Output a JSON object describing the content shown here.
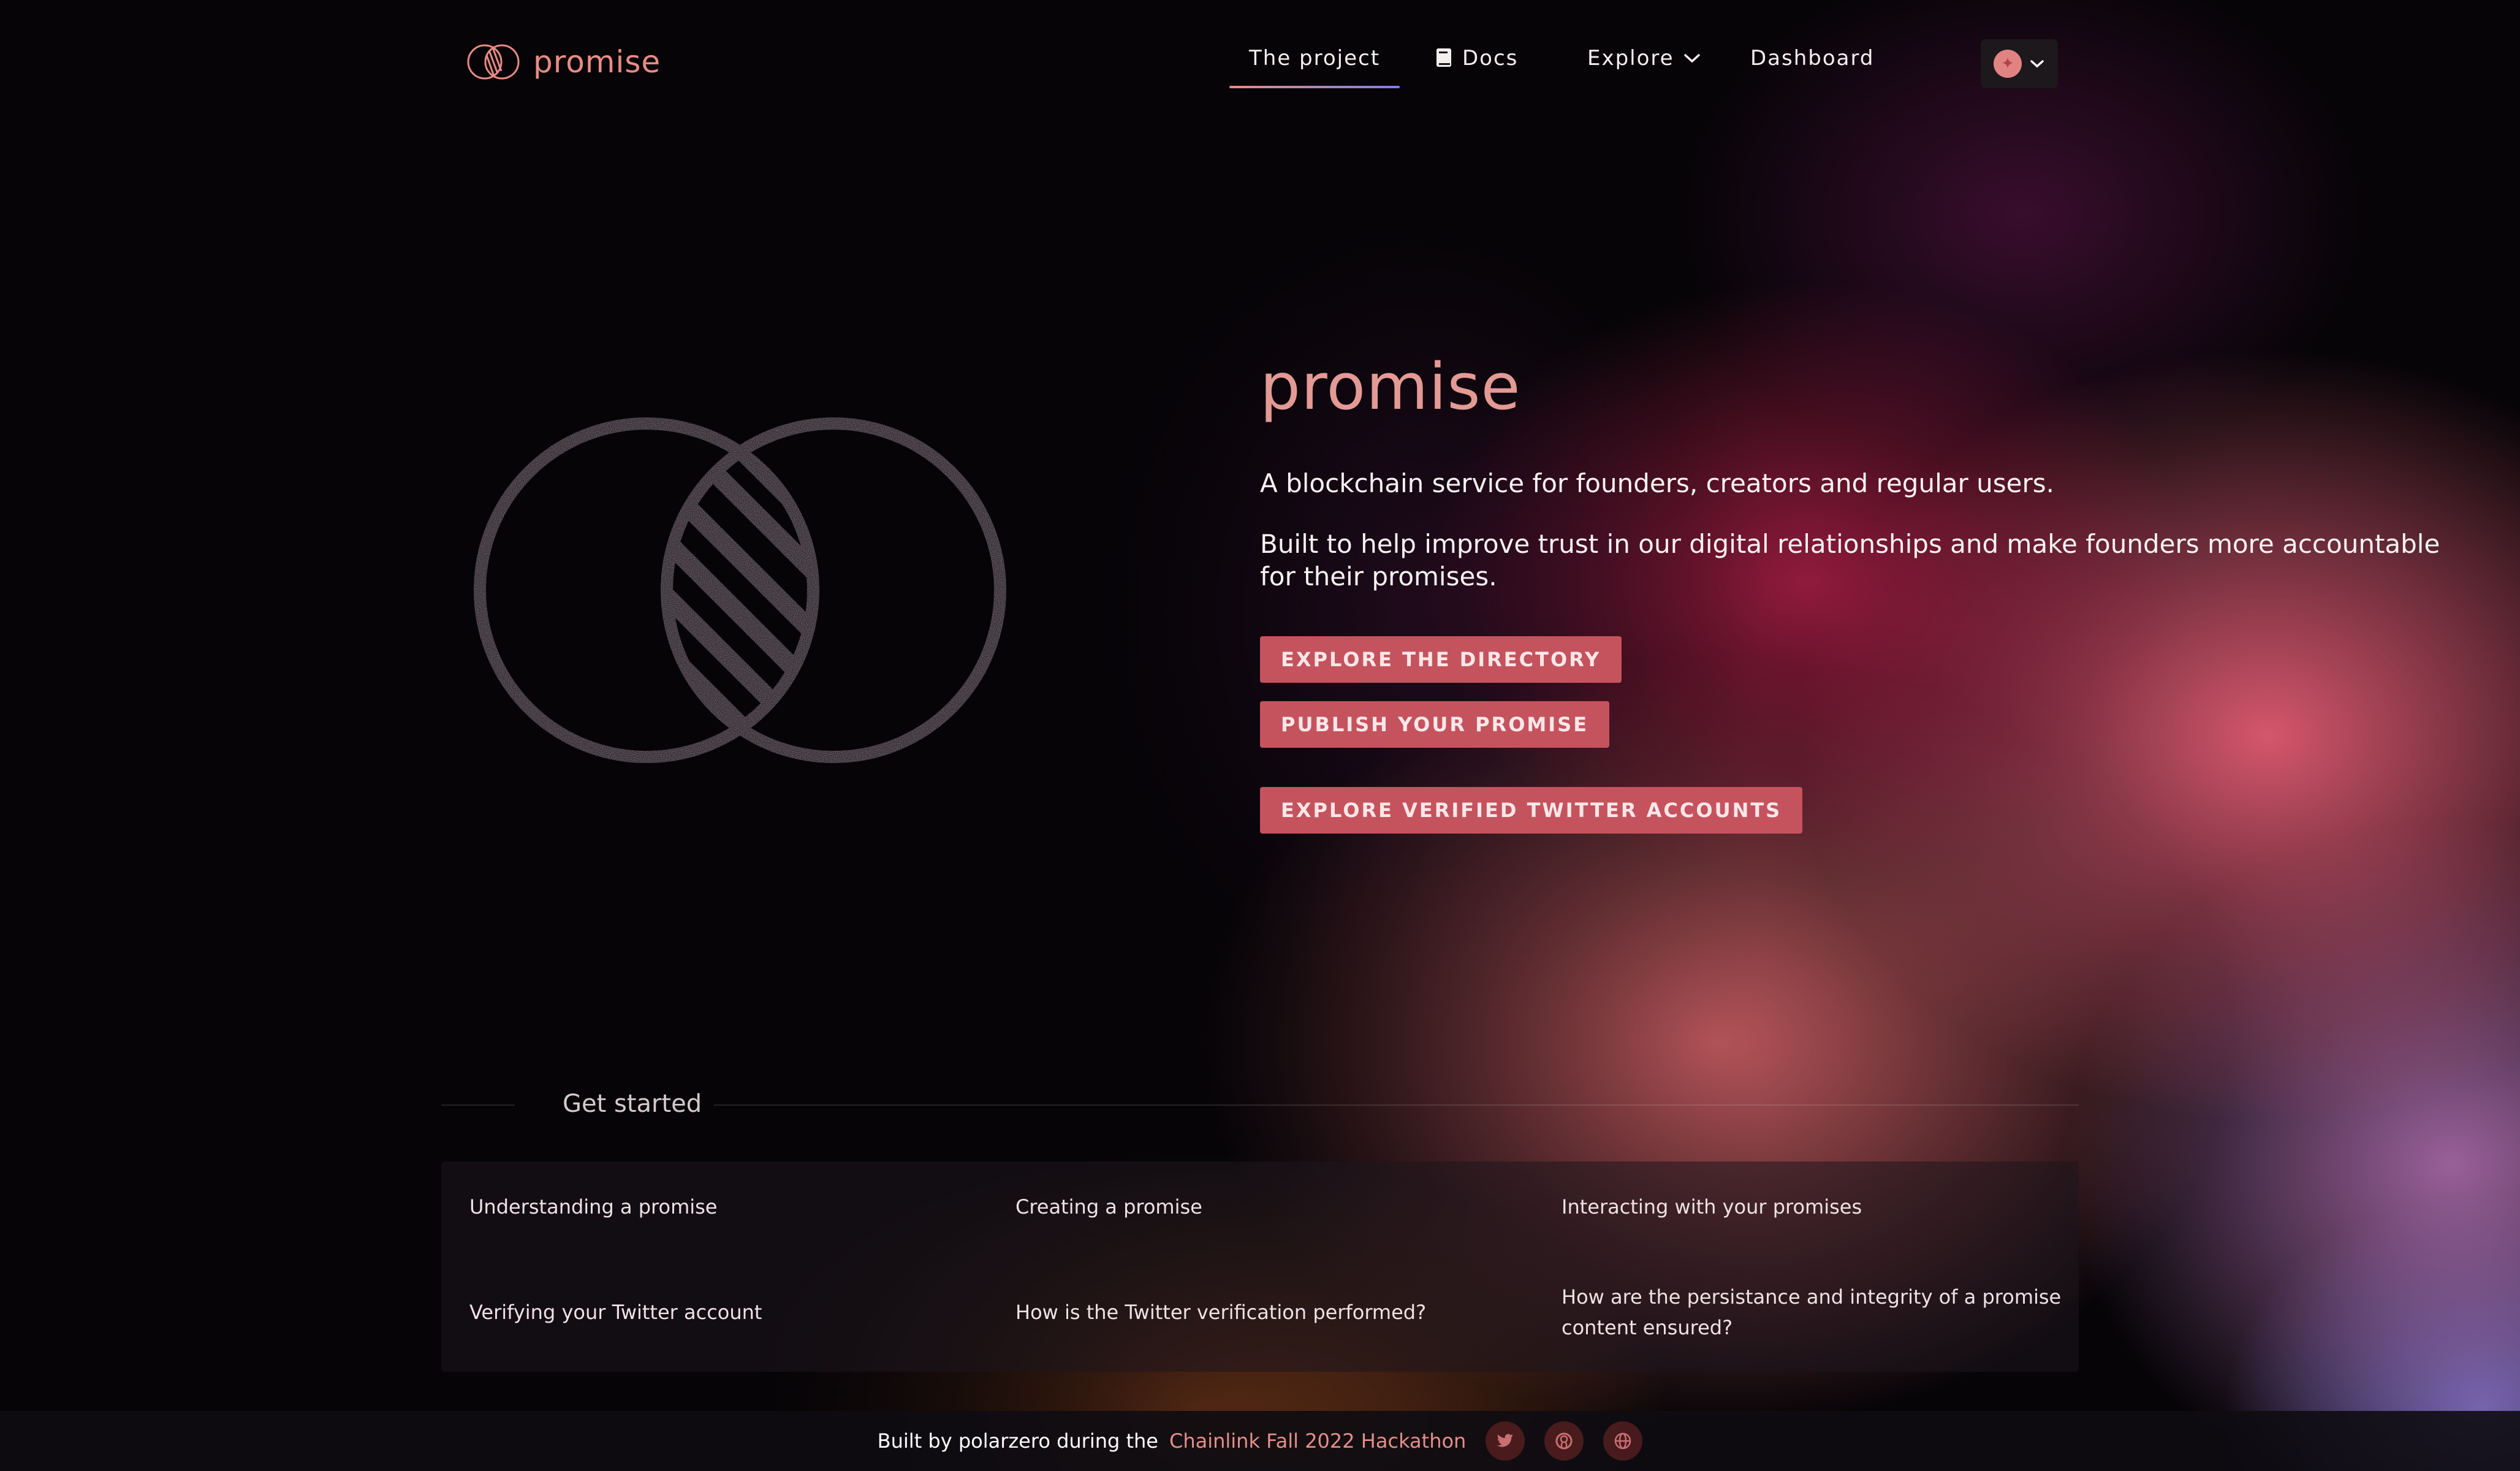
{
  "brand": {
    "name": "promise",
    "accent": "#e98b84"
  },
  "nav": {
    "items": [
      {
        "label": "The project",
        "active": true
      },
      {
        "label": "Docs",
        "icon": "book-icon"
      },
      {
        "label": "Explore",
        "icon": "chevron-down-icon"
      },
      {
        "label": "Dashboard"
      }
    ],
    "language_icon": "flag-icon"
  },
  "hero": {
    "title": "promise",
    "tagline": "A blockchain service for founders, creators and regular users.",
    "description": "Built to help improve trust in our digital relationships and make founders more accountable for their promises.",
    "buttons": {
      "directory": "EXPLORE THE DIRECTORY",
      "publish": "PUBLISH YOUR PROMISE",
      "twitter": "EXPLORE VERIFIED TWITTER ACCOUNTS"
    },
    "button_color": "#c5535d"
  },
  "get_started": {
    "title": "Get started",
    "links": [
      "Understanding a promise",
      "Creating a promise",
      "Interacting with your promises",
      "Verifying your Twitter account",
      "How is the Twitter verification performed?",
      "How are the persistance and integrity of a promise content ensured?"
    ]
  },
  "footer": {
    "text": "Built by polarzero during the",
    "link": "Chainlink Fall 2022 Hackathon",
    "icons": [
      "twitter-icon",
      "github-icon",
      "globe-icon"
    ]
  }
}
